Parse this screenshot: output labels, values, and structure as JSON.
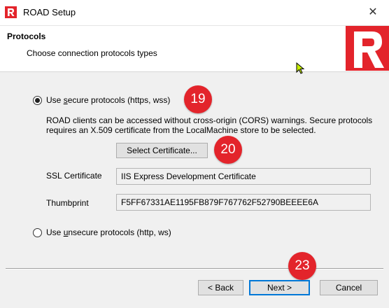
{
  "window": {
    "title": "ROAD Setup",
    "close_glyph": "✕",
    "app_icon": "road-r-logo-icon"
  },
  "header": {
    "title": "Protocols",
    "subtitle": "Choose connection protocols types"
  },
  "secure_option": {
    "label_prefix": "Use ",
    "label_accel": "s",
    "label_rest": "ecure protocols (https, wss)",
    "selected": true,
    "description": "ROAD clients can be accessed without cross-origin (CORS) warnings. Secure protocols requires an X.509 certificate from the LocalMachine store to be selected."
  },
  "select_certificate_button": "Select Certificate...",
  "ssl_certificate": {
    "label": "SSL Certificate",
    "value": "IIS Express Development Certificate"
  },
  "thumbprint": {
    "label": "Thumbprint",
    "value": "F5FF67331AE1195FB879F767762F52790BEEEE6A"
  },
  "unsecure_option": {
    "label_prefix": "Use ",
    "label_accel": "u",
    "label_rest": "nsecure protocols (http, ws)",
    "selected": false
  },
  "buttons": {
    "back": "< Back",
    "next": "Next >",
    "cancel": "Cancel"
  },
  "step_badges": [
    "19",
    "20",
    "23"
  ],
  "colors": {
    "brand_red": "#e3242b",
    "badge_red": "#e3242b",
    "default_button_border": "#0078d7"
  }
}
